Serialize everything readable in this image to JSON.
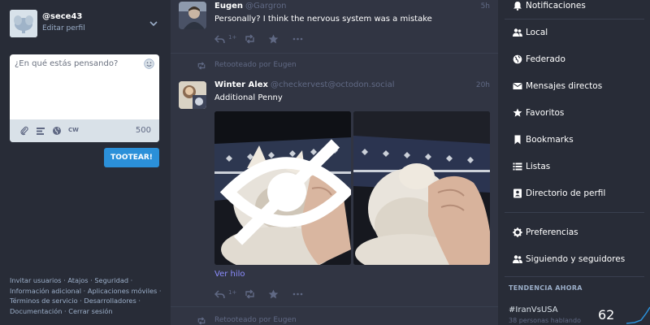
{
  "account": {
    "handle": "@sece43",
    "edit_profile": "Editar perfil"
  },
  "compose": {
    "placeholder": "¿En qué estás pensando?",
    "cw_label": "CW",
    "char_count": "500",
    "toot_button": "TOOTEAR!"
  },
  "footer": {
    "links": [
      "Invitar usuarios",
      "Atajos",
      "Seguridad",
      "Información adicional",
      "Aplicaciones móviles",
      "Términos de servicio",
      "Desarrolladores",
      "Documentación",
      "Cerrar sesión"
    ]
  },
  "timeline": {
    "status1": {
      "name": "Eugen",
      "handle": "@Gargron",
      "time": "5h",
      "text": "Personally? I think the nervous system was a mistake",
      "reply_count": "1+"
    },
    "reblog1": {
      "label": "Retooteado por Eugen"
    },
    "status2": {
      "name": "Winter Alex",
      "handle": "@checkervest@octodon.social",
      "time": "20h",
      "text": "Additional Penny",
      "thread_link": "Ver hilo",
      "reply_count": "1+"
    },
    "reblog2": {
      "label": "Retooteado por Eugen"
    }
  },
  "nav": {
    "items": [
      {
        "label": "Notificaciones",
        "icon": "bell-icon"
      },
      {
        "label": "Local",
        "icon": "users-icon"
      },
      {
        "label": "Federado",
        "icon": "globe-icon"
      },
      {
        "label": "Mensajes directos",
        "icon": "envelope-icon"
      },
      {
        "label": "Favoritos",
        "icon": "star-icon"
      },
      {
        "label": "Bookmarks",
        "icon": "bookmark-icon"
      },
      {
        "label": "Listas",
        "icon": "list-icon"
      },
      {
        "label": "Directorio de perfil",
        "icon": "address-book-icon"
      },
      {
        "label": "Preferencias",
        "icon": "gear-icon"
      },
      {
        "label": "Siguiendo y seguidores",
        "icon": "users-icon"
      }
    ]
  },
  "trends": {
    "heading": "TENDENCIA AHORA",
    "tag": "#IranVsUSA",
    "subtitle": "38 personas hablando",
    "count": "62"
  },
  "colors": {
    "accent": "#2b90d9",
    "link": "#8c8dff",
    "background": "#282c37",
    "timeline_bg": "#313543"
  }
}
